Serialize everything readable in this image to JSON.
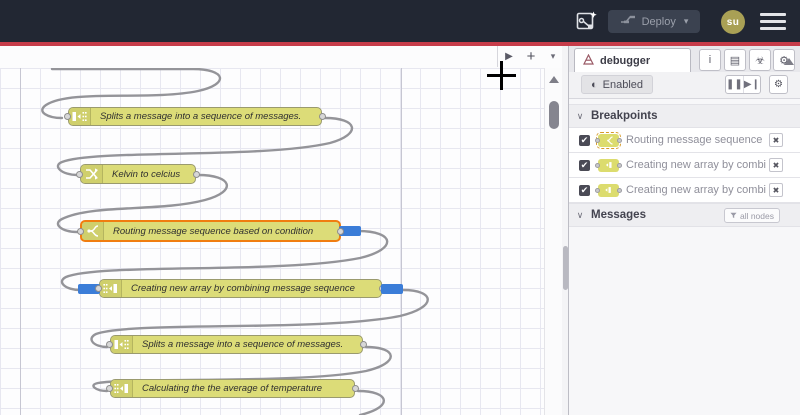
{
  "header": {
    "assistant_icon": "assistant-sparkle-icon",
    "deploy": {
      "label": "Deploy",
      "caret": "▾"
    },
    "avatar": {
      "initials": "su"
    }
  },
  "workspace": {
    "toolbar": {
      "run": "▶",
      "add": "+",
      "more": "▾"
    }
  },
  "canvas": {
    "nodes": [
      {
        "label": "Splits a message into a sequence of messages.",
        "icon": "split-node-icon"
      },
      {
        "label": "Kelvin to celcius",
        "icon": "change-node-icon"
      },
      {
        "label": "Routing message sequence based on condition",
        "icon": "switch-node-icon"
      },
      {
        "label": "Creating new array by combining message sequence",
        "icon": "join-node-icon"
      },
      {
        "label": "Splits a message into a sequence of messages.",
        "icon": "split-node-icon"
      },
      {
        "label": "Calculating the the average of temperature",
        "icon": "join-node-icon"
      }
    ]
  },
  "sidebar": {
    "tab": {
      "label": "debugger",
      "icon": "debug-icon"
    },
    "tab_buttons": [
      {
        "name": "info",
        "glyph": "i"
      },
      {
        "name": "help",
        "glyph": "▤"
      },
      {
        "name": "debug",
        "glyph": "☣"
      },
      {
        "name": "config",
        "glyph": "⚙"
      }
    ],
    "tab_more": "▾",
    "toolbar": {
      "enabled_label": "Enabled",
      "enabled_glyph": "◐",
      "pause": "❚❚",
      "step": "▶❙",
      "settings": "⚙"
    },
    "breakpoints_section": {
      "title": "Breakpoints",
      "chevron": "∨"
    },
    "breakpoints": [
      {
        "label": "Routing message sequence based on condition",
        "checked": "✔",
        "remove": "✖",
        "icon": "switch-node-icon"
      },
      {
        "label": "Creating new array by combining message sequence",
        "checked": "✔",
        "remove": "✖",
        "icon": "join-node-icon"
      },
      {
        "label": "Creating new array by combining message sequence",
        "checked": "✔",
        "remove": "✖",
        "icon": "join-node-icon"
      }
    ],
    "messages_section": {
      "title": "Messages",
      "chevron": "∨",
      "filter_label": "all nodes"
    }
  }
}
